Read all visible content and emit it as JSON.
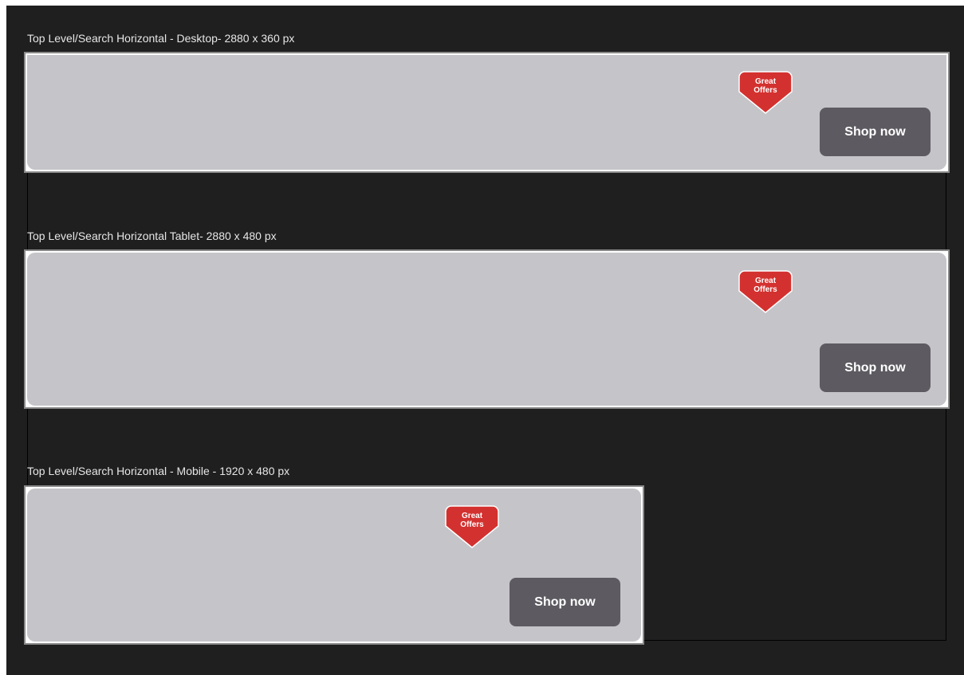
{
  "frames": [
    {
      "label": "Top Level/Search Horizontal - Desktop- 2880 x 360 px",
      "badge_text": "Great\nOffers",
      "button_label": "Shop now"
    },
    {
      "label": "Top Level/Search Horizontal Tablet- 2880 x 480 px",
      "badge_text": "Great\nOffers",
      "button_label": "Shop now"
    },
    {
      "label": "Top Level/Search Horizontal - Mobile - 1920 x 480 px",
      "badge_text": "Great\nOffers",
      "button_label": "Shop now"
    }
  ],
  "colors": {
    "canvas_bg": "#1f1f1f",
    "banner_bg": "#c5c4c8",
    "badge_red": "#d3312f",
    "button_bg": "#5d5b61",
    "label_text": "#e6e6e6"
  }
}
